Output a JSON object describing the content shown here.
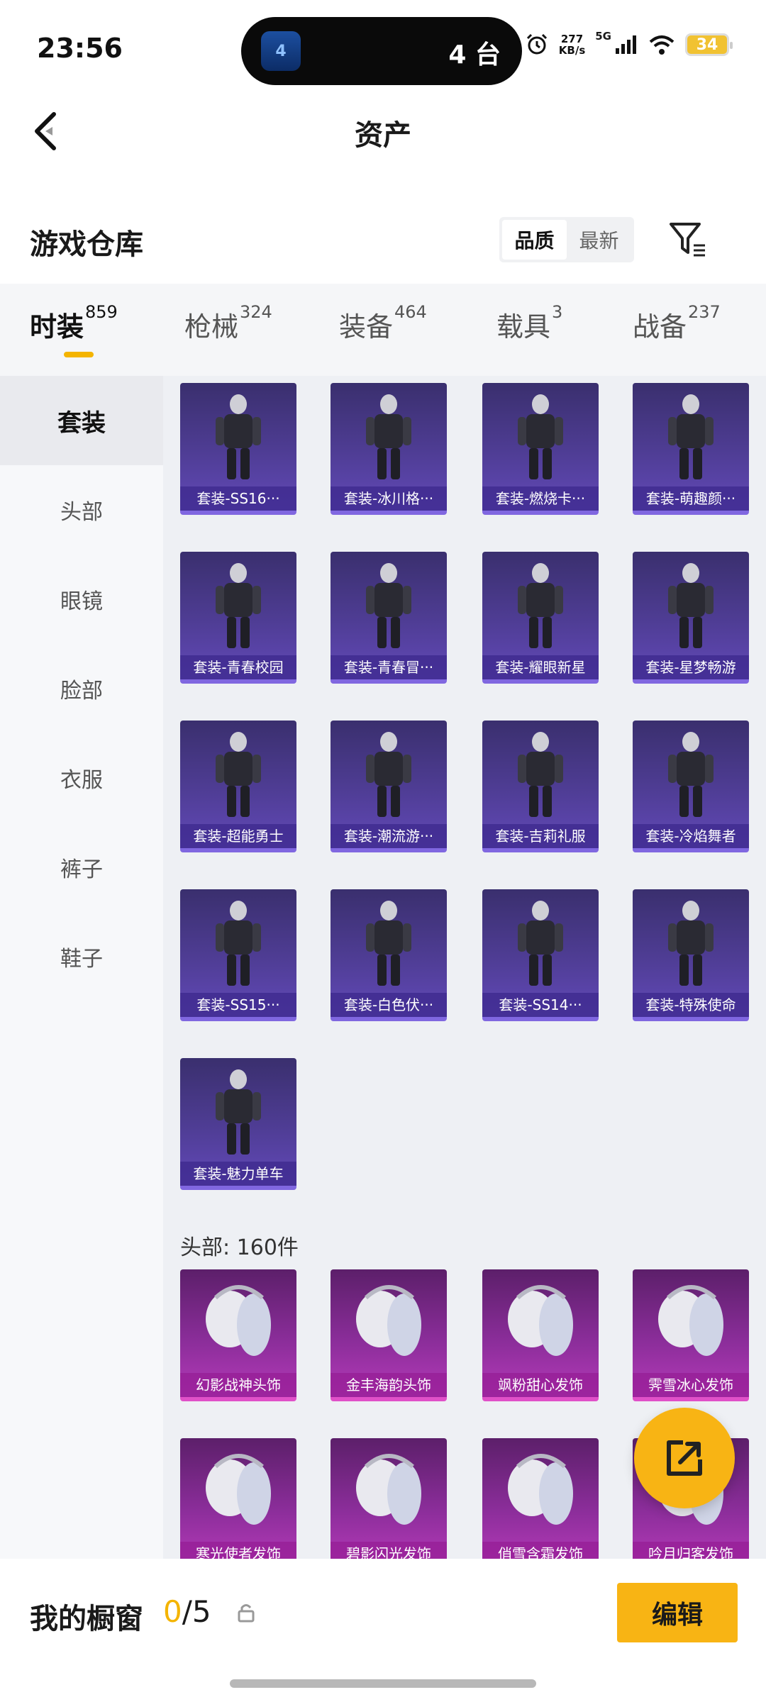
{
  "status_bar": {
    "time": "23:56",
    "island_app_label": "4",
    "island_text": "4 台",
    "net_speed_value": "277",
    "net_speed_unit": "KB/s",
    "signal_label": "5G",
    "battery": "34"
  },
  "header": {
    "title": "资产"
  },
  "warehouse": {
    "title": "游戏仓库",
    "sort_options": [
      "品质",
      "最新"
    ],
    "active_sort": "品质"
  },
  "category_tabs": [
    {
      "label": "时装",
      "count": "859",
      "active": true
    },
    {
      "label": "枪械",
      "count": "324",
      "active": false
    },
    {
      "label": "装备",
      "count": "464",
      "active": false
    },
    {
      "label": "载具",
      "count": "3",
      "active": false
    },
    {
      "label": "战备",
      "count": "237",
      "active": false
    }
  ],
  "sidebar": {
    "items": [
      "套装",
      "头部",
      "眼镜",
      "脸部",
      "衣服",
      "裤子",
      "鞋子"
    ],
    "active": "套装"
  },
  "suits": [
    "套装-SS16···",
    "套装-冰川格···",
    "套装-燃烧卡···",
    "套装-萌趣颜···",
    "套装-青春校园",
    "套装-青春冒···",
    "套装-耀眼新星",
    "套装-星梦畅游",
    "套装-超能勇士",
    "套装-潮流游···",
    "套装-吉莉礼服",
    "套装-冷焰舞者",
    "套装-SS15···",
    "套装-白色伏···",
    "套装-SS14···",
    "套装-特殊使命",
    "套装-魅力单车"
  ],
  "head_section": {
    "title": "头部: 160件"
  },
  "head_items": [
    "幻影战神头饰",
    "金丰海韵头饰",
    "飒粉甜心发饰",
    "霁雪冰心发饰",
    "寒光使者发饰",
    "碧影闪光发饰",
    "俏雪含霜发饰",
    "吟月归客发饰"
  ],
  "bottom_bar": {
    "label": "我的橱窗",
    "current": "0",
    "total": "/5",
    "edit_label": "编辑"
  },
  "colors": {
    "accent": "#f8b414",
    "suit_card": "#4f3d95",
    "head_card": "#8a2d99"
  }
}
